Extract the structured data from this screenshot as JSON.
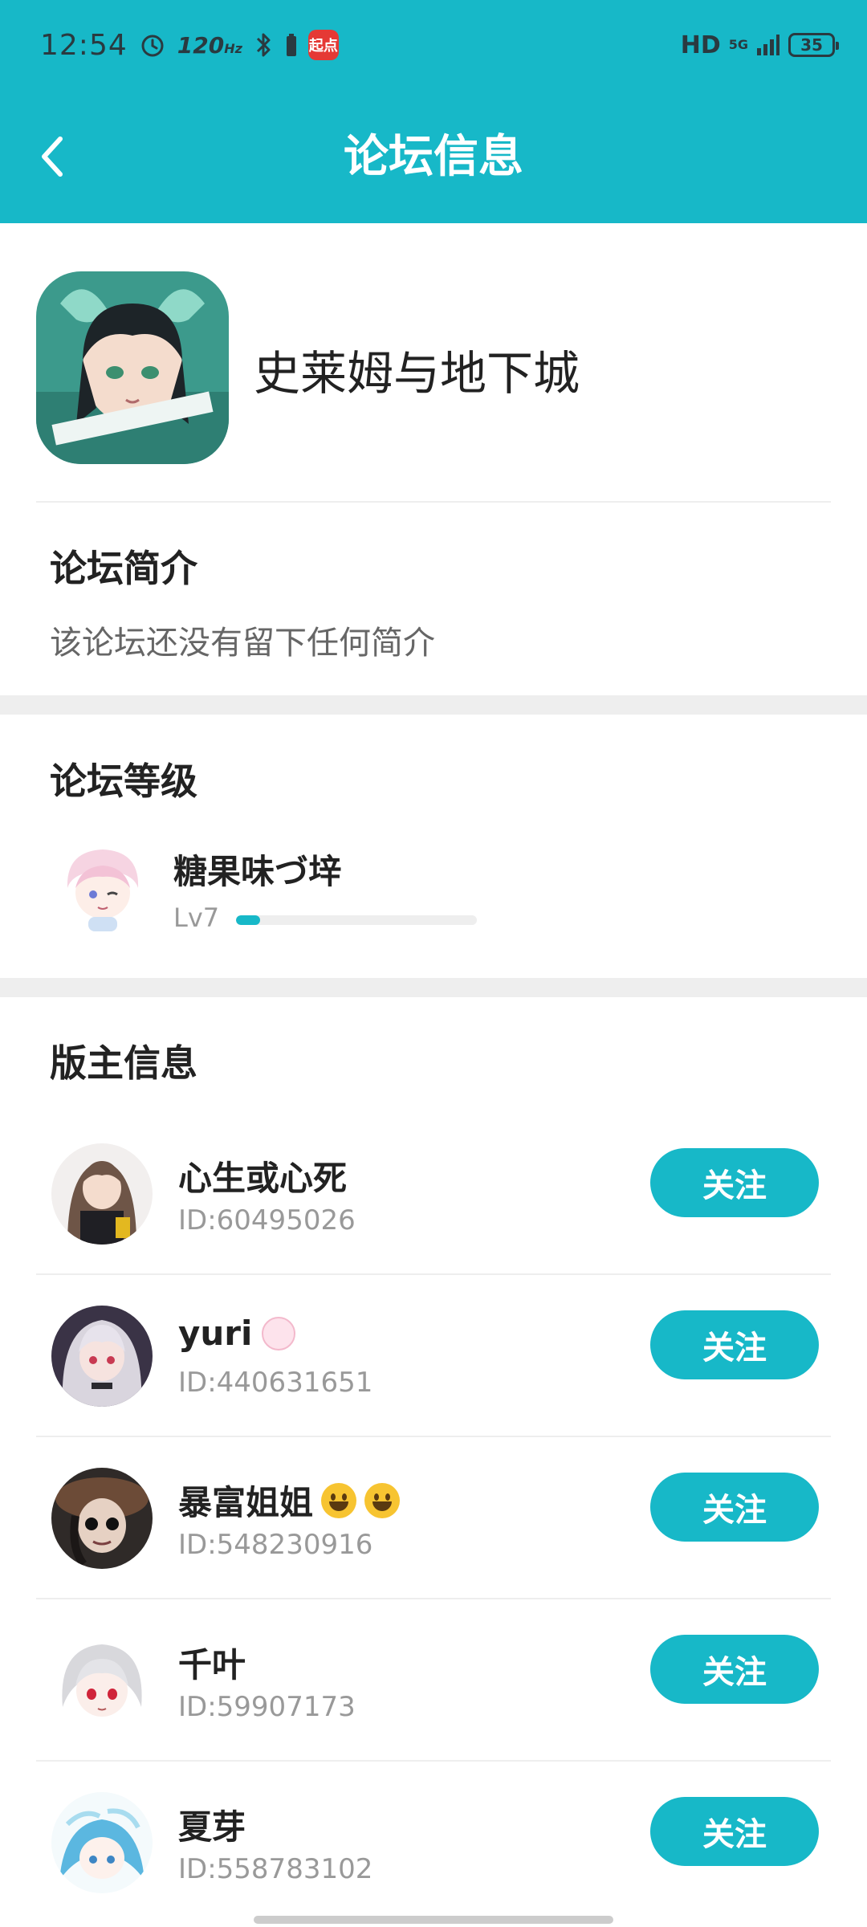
{
  "status_bar": {
    "time": "12:54",
    "refresh_rate": "120",
    "refresh_unit": "Hz",
    "app_badge": "起点",
    "network_type": "HD",
    "signal": "5G",
    "battery": "35"
  },
  "header": {
    "title": "论坛信息",
    "back_icon": "chevron-left-icon"
  },
  "forum": {
    "name": "史莱姆与地下城"
  },
  "intro": {
    "title": "论坛简介",
    "text": "该论坛还没有留下任何简介"
  },
  "level": {
    "title": "论坛等级",
    "user_name": "糖果味づ垶",
    "level_label": "Lv7",
    "progress_fraction": 0.1
  },
  "moderators": {
    "title": "版主信息",
    "follow_label": "关注",
    "items": [
      {
        "name": "心生或心死",
        "id": "ID:60495026"
      },
      {
        "name": "yuri",
        "id": "ID:440631651"
      },
      {
        "name": "暴富姐姐",
        "id": "ID:548230916"
      },
      {
        "name": "千叶",
        "id": "ID:59907173"
      },
      {
        "name": "夏芽",
        "id": "ID:558783102"
      }
    ]
  },
  "colors": {
    "accent": "#17b8c8",
    "divider_band": "#eeeeee",
    "secondary_text": "#999999"
  }
}
